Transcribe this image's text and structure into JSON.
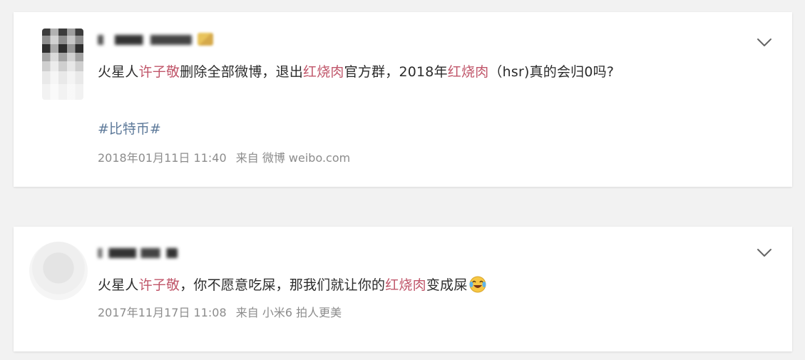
{
  "posts": [
    {
      "text_parts": [
        {
          "text": "火星人",
          "hl": false
        },
        {
          "text": "许子敬",
          "hl": true
        },
        {
          "text": "删除全部微博，退出",
          "hl": false
        },
        {
          "text": "红烧肉",
          "hl": true
        },
        {
          "text": "官方群，2018年",
          "hl": false
        },
        {
          "text": "红烧肉",
          "hl": true
        },
        {
          "text": "（hsr)真的会归0吗?",
          "hl": false
        }
      ],
      "hashtag": "#比特币#",
      "time": "2018年01月11日 11:40",
      "source_prefix": "来自",
      "source": "微博 weibo.com",
      "icons": {
        "menu": "chevron-down-icon",
        "badge": "vip-badge-icon"
      }
    },
    {
      "text_parts": [
        {
          "text": "火星人",
          "hl": false
        },
        {
          "text": "许子敬",
          "hl": true
        },
        {
          "text": "，你不愿意吃屎，那我们就让你的",
          "hl": false
        },
        {
          "text": "红烧肉",
          "hl": true
        },
        {
          "text": "变成屎",
          "hl": false
        }
      ],
      "time": "2017年11月17日 11:08",
      "source_prefix": "来自",
      "source": "小米6 拍人更美",
      "icons": {
        "menu": "chevron-down-icon",
        "emoji": "laughing-crying-emoji-icon"
      }
    }
  ],
  "colors": {
    "highlight": "#c0566a",
    "hashtag": "#5e7a9a",
    "meta": "#8c8c8c",
    "text": "#2b2b2b",
    "background": "#f2f2f2"
  }
}
